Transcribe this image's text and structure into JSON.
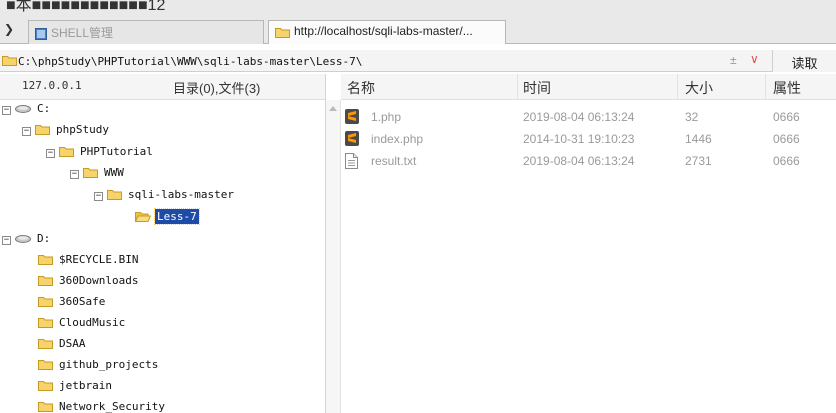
{
  "window": {
    "title_fragment": "■本■■■■■■■■■■■■12"
  },
  "tabs": [
    {
      "label": "SHELL管理",
      "icon": "shell-icon",
      "active": false
    },
    {
      "label": "http://localhost/sqli-labs-master/...",
      "icon": "folder-icon",
      "active": true
    }
  ],
  "pathbar": {
    "path": "C:\\phpStudy\\PHPTutorial\\WWW\\sqli-labs-master\\Less-7\\",
    "read_label": "读取",
    "plus_minus": "±",
    "dropdown": "∨"
  },
  "left": {
    "ip": "127.0.0.1",
    "stats": "目录(0),文件(3)",
    "tree": [
      {
        "label": "C:",
        "expander": "−",
        "icon": "drive-icon"
      },
      {
        "label": "phpStudy",
        "expander": "−",
        "icon": "folder-icon"
      },
      {
        "label": "PHPTutorial",
        "expander": "−",
        "icon": "folder-icon"
      },
      {
        "label": "WWW",
        "expander": "−",
        "icon": "folder-icon"
      },
      {
        "label": "sqli-labs-master",
        "expander": "−",
        "icon": "folder-icon"
      },
      {
        "label": "Less-7",
        "expander": "",
        "icon": "folder-open-icon",
        "selected": true
      },
      {
        "label": "D:",
        "expander": "−",
        "icon": "drive-icon"
      },
      {
        "label": "$RECYCLE.BIN",
        "expander": "",
        "icon": "folder-icon"
      },
      {
        "label": "360Downloads",
        "expander": "",
        "icon": "folder-icon"
      },
      {
        "label": "360Safe",
        "expander": "",
        "icon": "folder-icon"
      },
      {
        "label": "CloudMusic",
        "expander": "",
        "icon": "folder-icon"
      },
      {
        "label": "DSAA",
        "expander": "",
        "icon": "folder-icon"
      },
      {
        "label": "github_projects",
        "expander": "",
        "icon": "folder-icon"
      },
      {
        "label": "jetbrain",
        "expander": "",
        "icon": "folder-icon"
      },
      {
        "label": "Network_Security",
        "expander": "",
        "icon": "folder-icon"
      }
    ]
  },
  "right": {
    "columns": {
      "name": "名称",
      "time": "时间",
      "size": "大小",
      "attr": "属性"
    },
    "files": [
      {
        "name": "1.php",
        "time": "2019-08-04 06:13:24",
        "size": "32",
        "attr": "0666",
        "icon": "sublime-icon"
      },
      {
        "name": "index.php",
        "time": "2014-10-31 19:10:23",
        "size": "1446",
        "attr": "0666",
        "icon": "sublime-icon"
      },
      {
        "name": "result.txt",
        "time": "2019-08-04 06:13:24",
        "size": "2731",
        "attr": "0666",
        "icon": "text-file-icon"
      }
    ]
  },
  "colors": {
    "selection": "#1e4ba8",
    "folder": "#f2c14e",
    "sublime": "#ff9800"
  }
}
